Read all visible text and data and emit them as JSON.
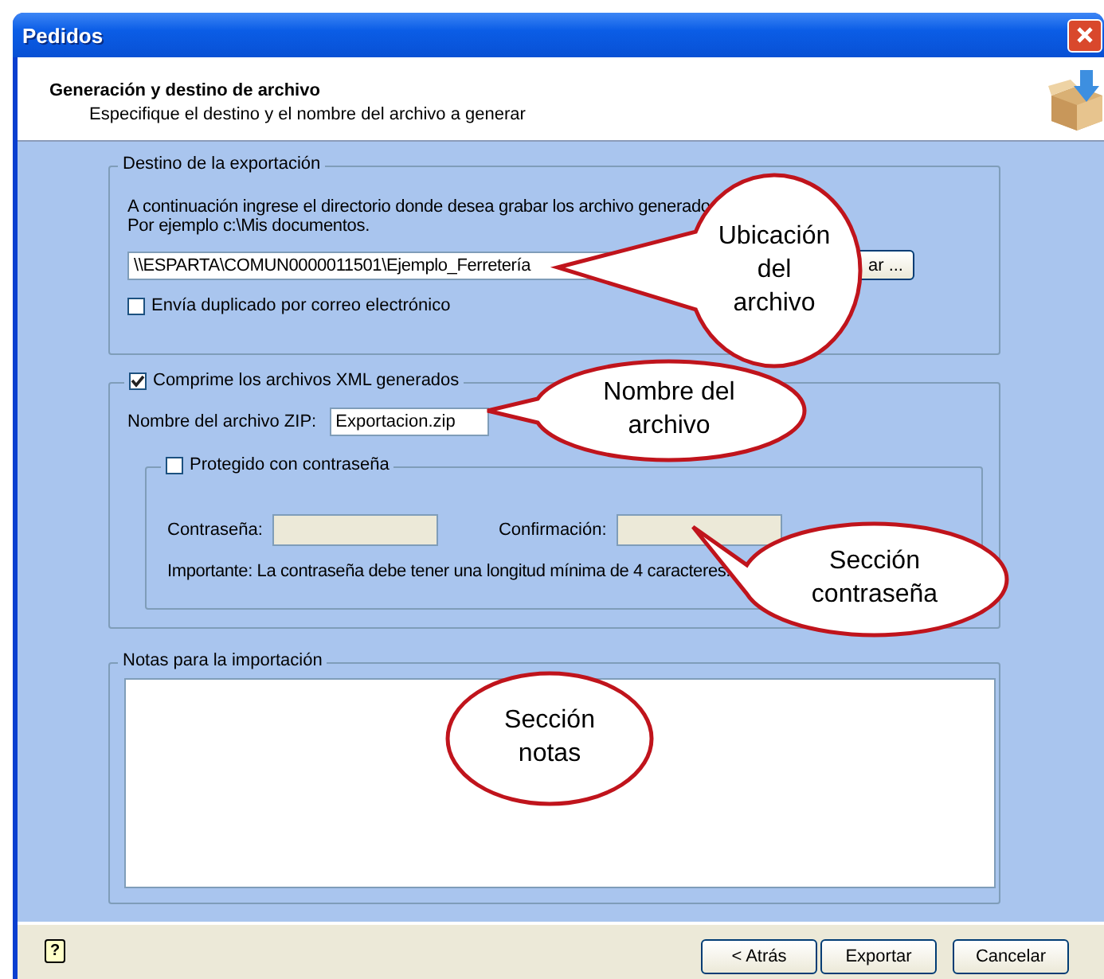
{
  "window": {
    "title": "Pedidos"
  },
  "header": {
    "title": "Generación y destino de archivo",
    "subtitle": "Especifique el destino y el nombre del archivo a generar"
  },
  "destination": {
    "legend": "Destino de la exportación",
    "instructions": [
      "A continuación ingrese el directorio donde desea grabar los archivo generado",
      "Por ejemplo c:\\Mis documentos."
    ],
    "path": "\\\\ESPARTA\\COMUN0000011501\\Ejemplo_Ferretería",
    "browse_button": "ar ...",
    "email_duplicate": {
      "label": "Envía duplicado por correo electrónico",
      "checked": false
    }
  },
  "compression": {
    "label": "Comprime los archivos XML generados",
    "checked": true,
    "zip_name_label": "Nombre del archivo ZIP:",
    "zip_name": "Exportacion.zip",
    "password": {
      "label": "Protegido con contraseña",
      "checked": false,
      "password_label": "Contraseña:",
      "confirm_label": "Confirmación:",
      "note": "Importante: La contraseña debe tener una longitud mínima de 4 caracteres."
    }
  },
  "notes": {
    "legend": "Notas para la importación"
  },
  "callouts": [
    {
      "text": "Ubicación\ndel\narchivo"
    },
    {
      "text": "Nombre del\narchivo"
    },
    {
      "text": "Sección\ncontraseña"
    },
    {
      "text": "Sección\nnotas"
    }
  ],
  "footer": {
    "help": "?",
    "buttons": [
      "< Atrás",
      "Exportar",
      "Cancelar"
    ]
  }
}
